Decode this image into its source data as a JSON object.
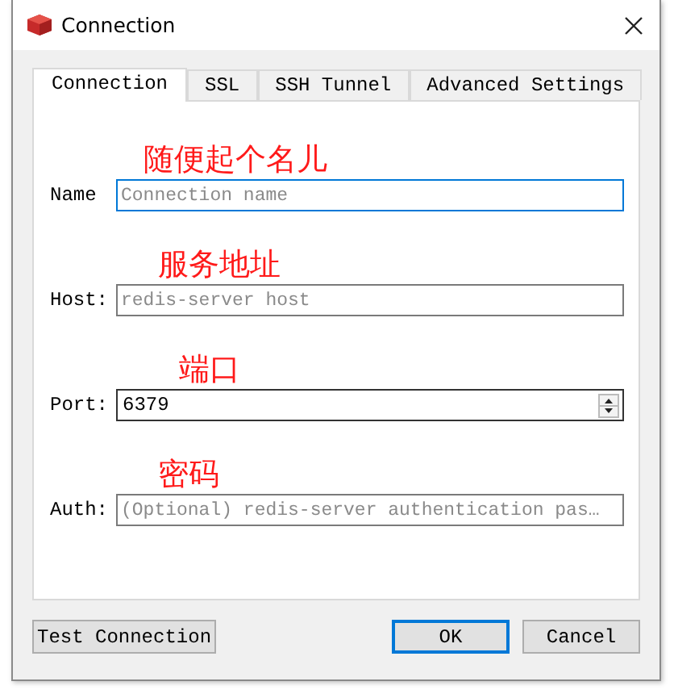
{
  "window": {
    "title": "Connection"
  },
  "tabs": [
    {
      "label": "Connection",
      "selected": true
    },
    {
      "label": "SSL",
      "selected": false
    },
    {
      "label": "SSH Tunnel",
      "selected": false
    },
    {
      "label": "Advanced Settings",
      "selected": false
    }
  ],
  "fields": [
    {
      "label": "Name",
      "kind": "text",
      "placeholder": "Connection name",
      "focused": true,
      "annotation": "随便起个名儿"
    },
    {
      "label": "Host:",
      "kind": "text",
      "placeholder": "redis-server host",
      "focused": false,
      "annotation": "服务地址"
    },
    {
      "label": "Port:",
      "kind": "spinner",
      "value": "6379",
      "focused": false,
      "annotation": "端口"
    },
    {
      "label": "Auth:",
      "kind": "text",
      "placeholder": "(Optional) redis-server authentication pas…",
      "focused": false,
      "annotation": "密码"
    }
  ],
  "buttons": [
    {
      "label": "Test Connection",
      "default": false
    },
    {
      "label": "OK",
      "default": true
    },
    {
      "label": "Cancel",
      "default": false
    }
  ]
}
